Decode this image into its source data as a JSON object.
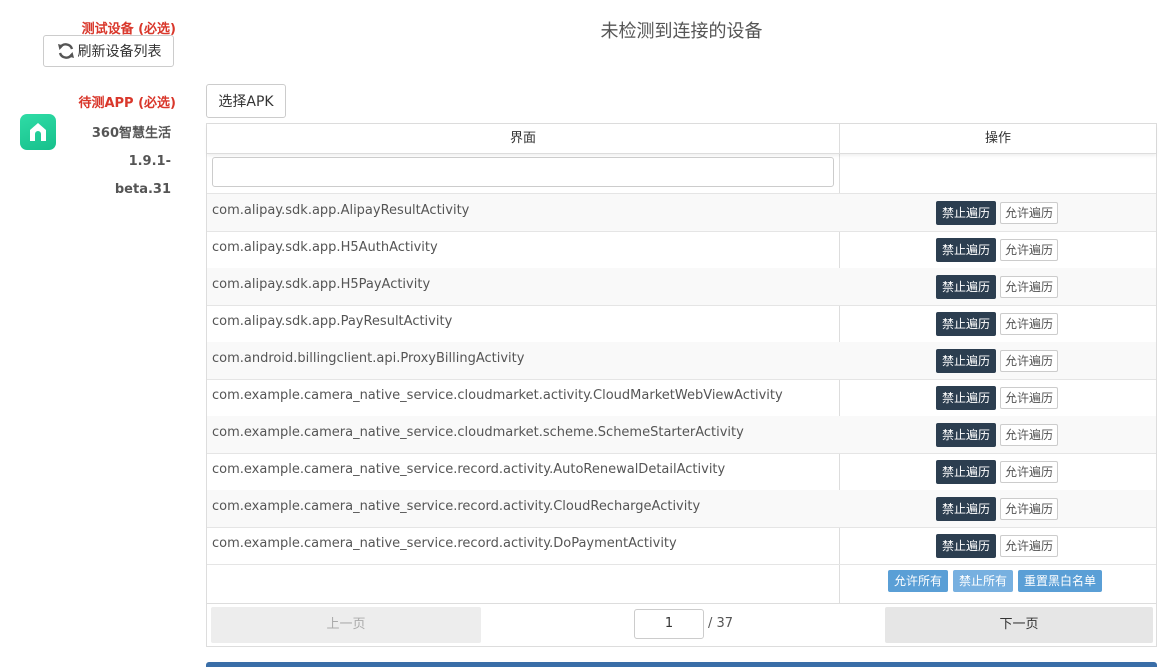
{
  "sidebar": {
    "device_label": "测试设备 (必选)",
    "refresh_label": "刷新设备列表",
    "app_label": "待测APP (必选)",
    "app_name_line1": "360智慧生活 1.9.1-",
    "app_name_line2": "beta.31",
    "app_icon": "home-icon",
    "app_icon_color": "#20cc96"
  },
  "header": {
    "status": "未检测到连接的设备"
  },
  "toolbar": {
    "select_apk_label": "选择APK"
  },
  "table": {
    "columns": [
      "界面",
      "操作"
    ],
    "filter_value": "",
    "deny_label": "禁止遍历",
    "allow_label": "允许遍历",
    "rows": [
      "com.alipay.sdk.app.AlipayResultActivity",
      "com.alipay.sdk.app.H5AuthActivity",
      "com.alipay.sdk.app.H5PayActivity",
      "com.alipay.sdk.app.PayResultActivity",
      "com.android.billingclient.api.ProxyBillingActivity",
      "com.example.camera_native_service.cloudmarket.activity.CloudMarketWebViewActivity",
      "com.example.camera_native_service.cloudmarket.scheme.SchemeStarterActivity",
      "com.example.camera_native_service.record.activity.AutoRenewalDetailActivity",
      "com.example.camera_native_service.record.activity.CloudRechargeActivity",
      "com.example.camera_native_service.record.activity.DoPaymentActivity"
    ],
    "footer": {
      "allow_all": "允许所有",
      "deny_all": "禁止所有",
      "reset": "重置黑白名单"
    }
  },
  "pager": {
    "prev_label": "上一页",
    "current_page": "1",
    "total": "/ 37",
    "next_label": "下一页"
  },
  "colors": {
    "required_label": "#d9372b",
    "deny_button": "#2c3e50",
    "action_blue": "#5a9fd6",
    "bottom_bar": "#3a6ea8"
  }
}
